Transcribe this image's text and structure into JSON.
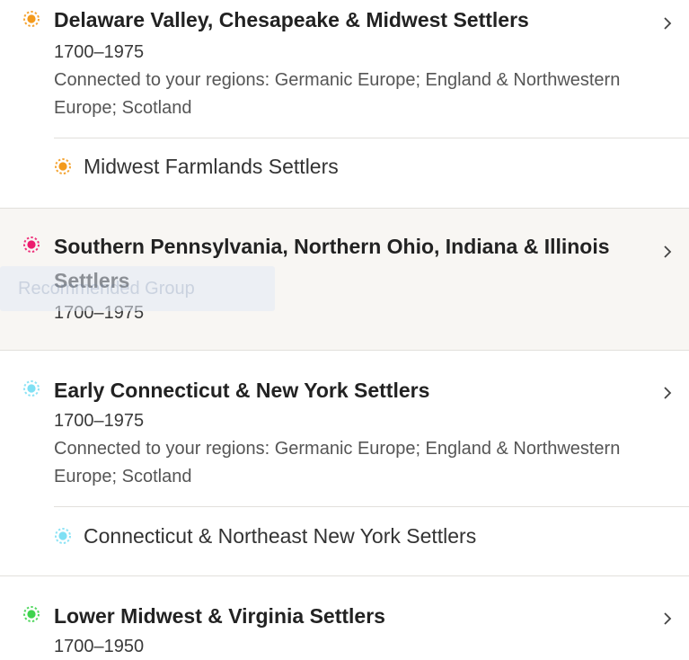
{
  "regions": [
    {
      "title": "Delaware Valley, Chesapeake & Midwest Settlers",
      "years": "1700–1975",
      "connected": "Connected to your regions: Germanic Europe; England & Northwestern Europe; Scotland",
      "color": "#f39a1c",
      "sub": {
        "title": "Midwest Farmlands Settlers",
        "color": "#f39a1c"
      }
    },
    {
      "title": "Southern Pennsylvania, Northern Ohio, Indiana & Illinois Settlers",
      "years": "1700–1975",
      "color": "#ec1c6e"
    },
    {
      "title": "Early Connecticut & New York Settlers",
      "years": "1700–1975",
      "connected": "Connected to your regions: Germanic Europe; England & Northwestern Europe; Scotland",
      "color": "#7fe0f4",
      "sub": {
        "title": "Connecticut & Northeast New York Settlers",
        "color": "#7fe0f4"
      }
    },
    {
      "title": "Lower Midwest & Virginia Settlers",
      "years": "1700–1950",
      "color": "#3ed34e"
    }
  ],
  "ghost_label": "Recommended Group",
  "icons": {
    "dot": "community-dot-icon",
    "chevron": "chevron-right-icon"
  }
}
